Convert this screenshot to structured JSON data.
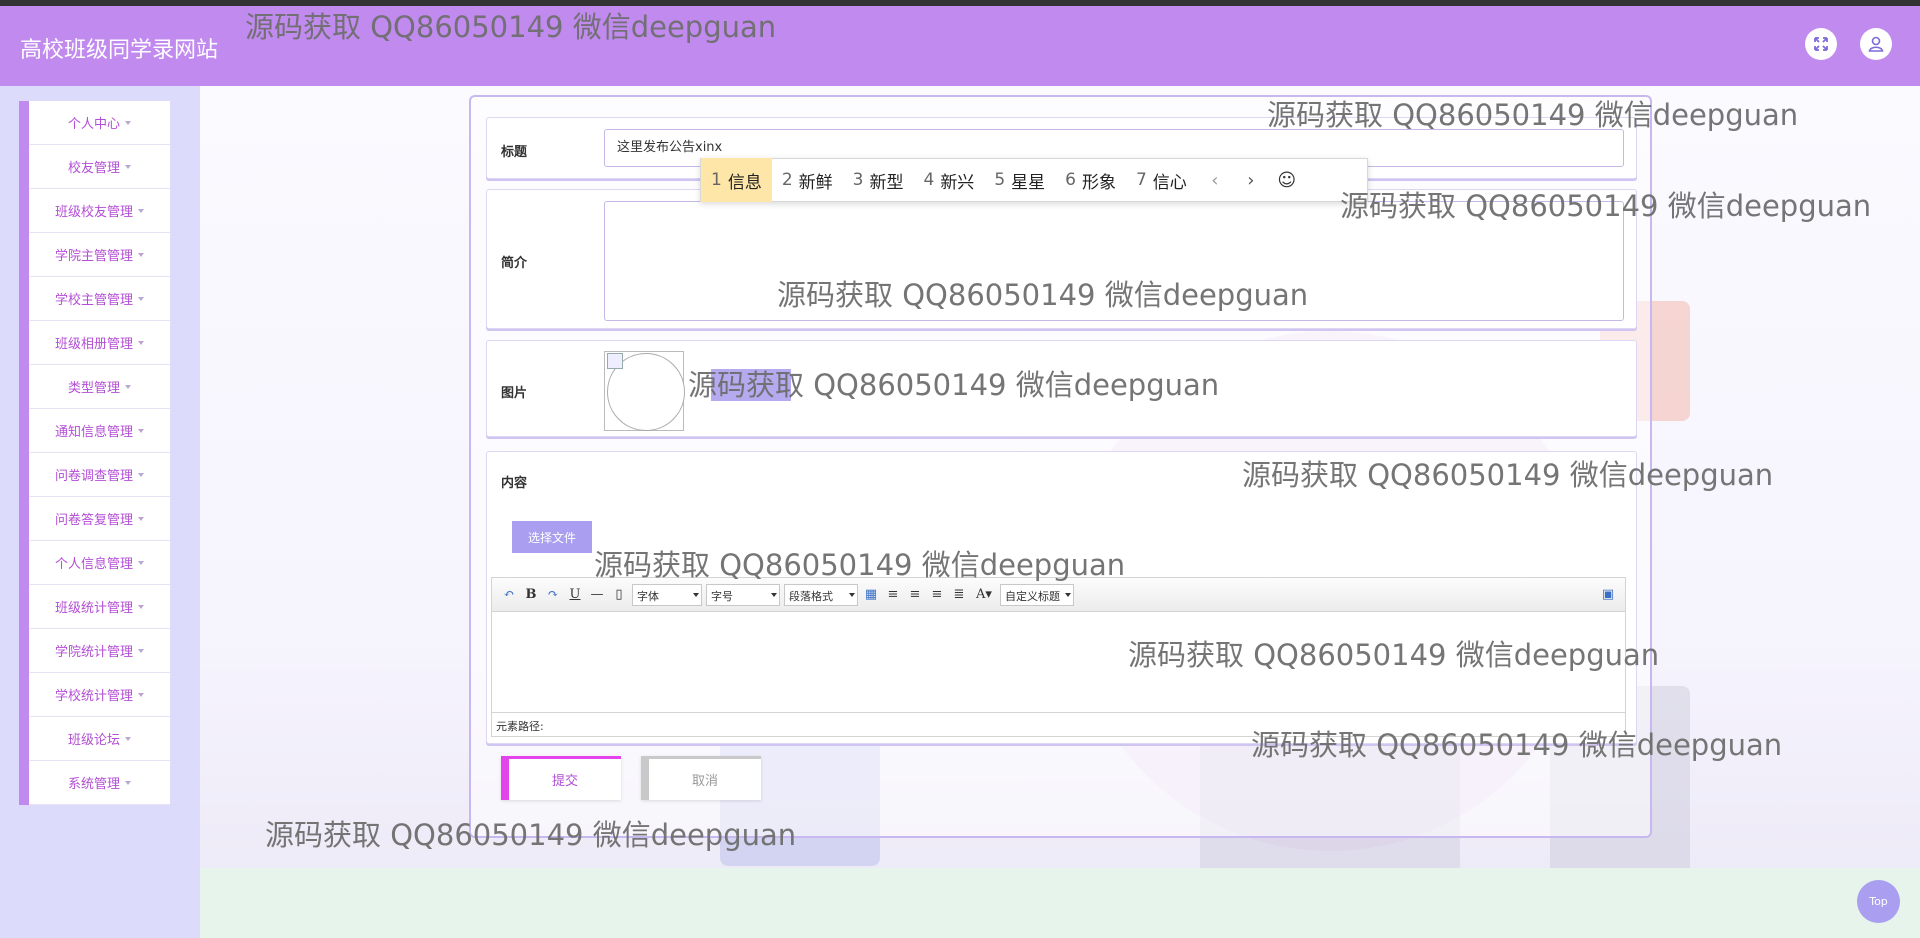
{
  "header": {
    "site_title": "高校班级同学录网站",
    "fullscreen_icon": "fullscreen-icon",
    "user_icon": "user-icon",
    "bar_color": "#c18aef"
  },
  "sidebar": {
    "items": [
      {
        "label": "个人中心"
      },
      {
        "label": "校友管理"
      },
      {
        "label": "班级校友管理"
      },
      {
        "label": "学院主管管理"
      },
      {
        "label": "学校主管管理"
      },
      {
        "label": "班级相册管理"
      },
      {
        "label": "类型管理"
      },
      {
        "label": "通知信息管理"
      },
      {
        "label": "问卷调查管理"
      },
      {
        "label": "问卷答复管理"
      },
      {
        "label": "个人信息管理"
      },
      {
        "label": "班级统计管理"
      },
      {
        "label": "学院统计管理"
      },
      {
        "label": "学校统计管理"
      },
      {
        "label": "班级论坛"
      },
      {
        "label": "系统管理"
      }
    ]
  },
  "form": {
    "title_label": "标题",
    "title_value": "这里发布公告xinx",
    "intro_label": "简介",
    "image_label": "图片",
    "content_label": "内容",
    "file_button": "选择文件",
    "submit_button": "提交",
    "cancel_button": "取消"
  },
  "ime": {
    "candidates": [
      {
        "num": "1",
        "text": "信息"
      },
      {
        "num": "2",
        "text": "新鲜"
      },
      {
        "num": "3",
        "text": "新型"
      },
      {
        "num": "4",
        "text": "新兴"
      },
      {
        "num": "5",
        "text": "星星"
      },
      {
        "num": "6",
        "text": "形象"
      },
      {
        "num": "7",
        "text": "信心"
      }
    ],
    "prev": "‹",
    "next": "›",
    "emoji": "☺"
  },
  "editor": {
    "font_select": "字体",
    "size_select": "字号",
    "paragraph_select": "段落格式",
    "custom_title_select": "自定义标题",
    "path_label": "元素路径:"
  },
  "top_button": "Top",
  "watermark": "源码获取 QQ86050149 微信deepguan"
}
